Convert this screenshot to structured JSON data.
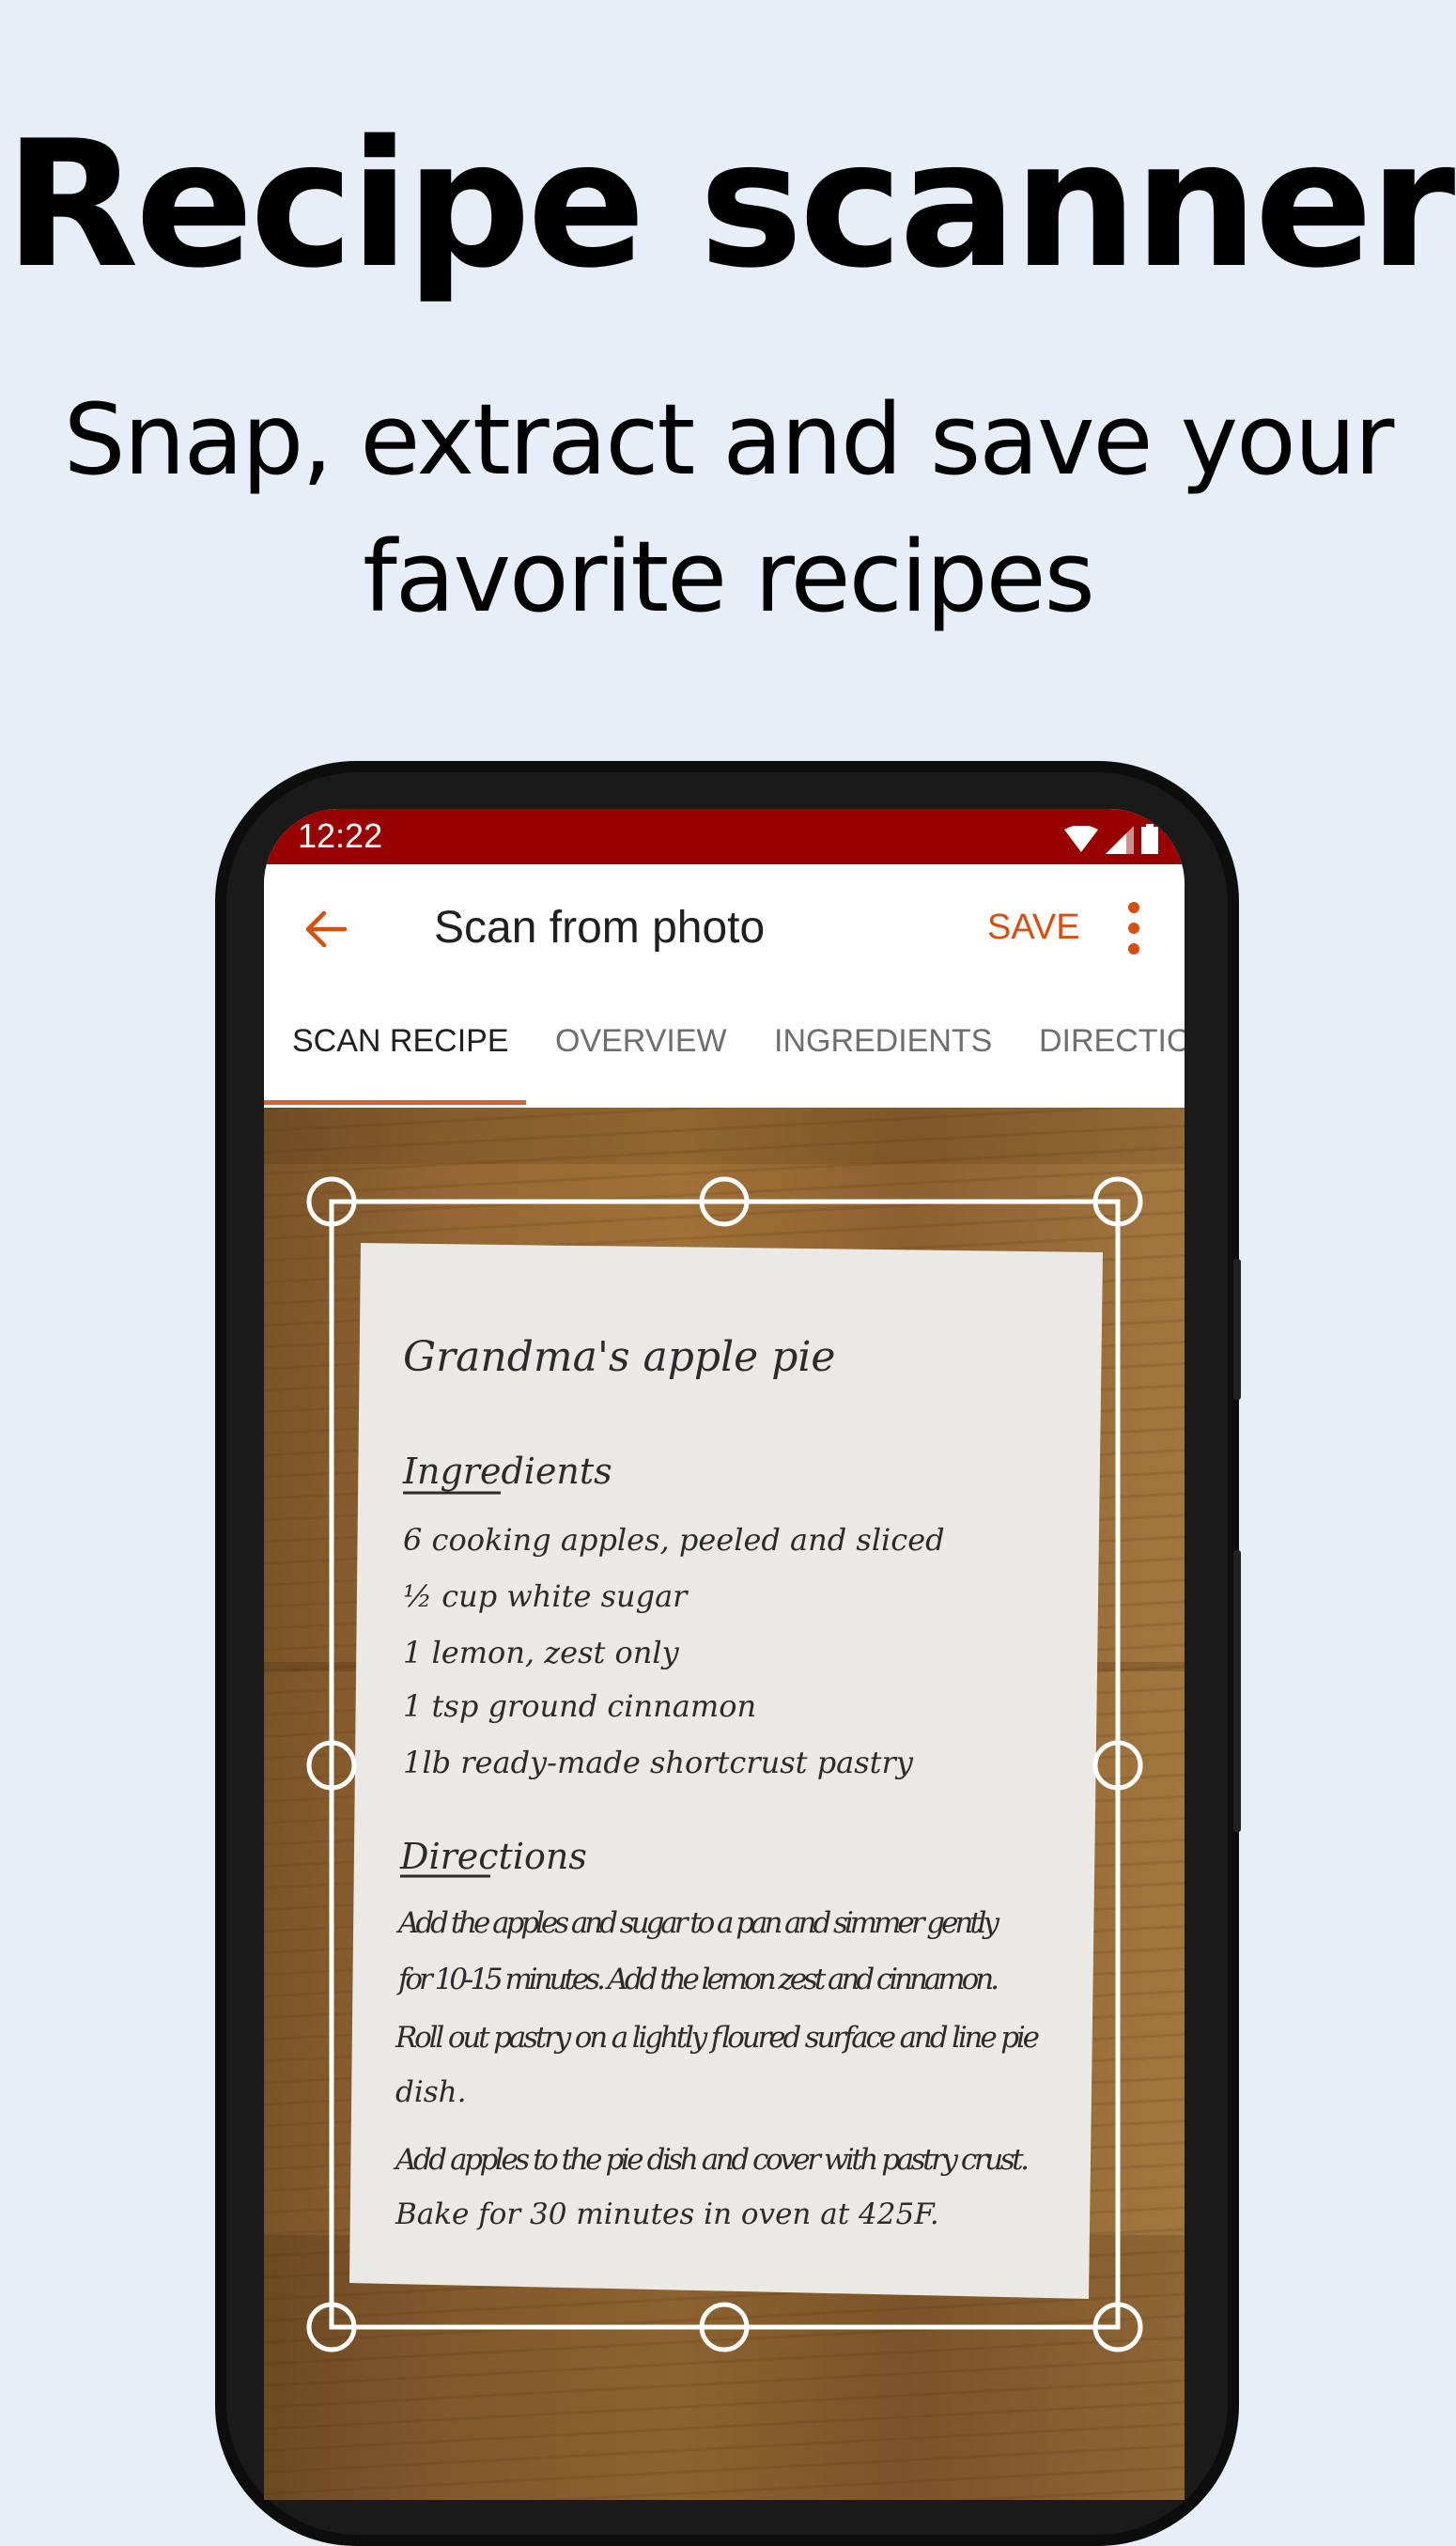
{
  "hero": {
    "title": "Recipe scanner",
    "subtitle_line1": "Snap, extract and save your",
    "subtitle_line2": "favorite recipes"
  },
  "status_bar": {
    "time": "12:22",
    "icons": [
      "wifi-icon",
      "signal-icon",
      "battery-icon"
    ],
    "color": "#990000"
  },
  "app_bar": {
    "back_icon": "arrow-left-icon",
    "title": "Scan from photo",
    "save_label": "SAVE",
    "more_icon": "more-vertical-icon",
    "accent": "#d5500f"
  },
  "tabs": [
    {
      "label": "SCAN RECIPE",
      "active": true
    },
    {
      "label": "OVERVIEW",
      "active": false
    },
    {
      "label": "INGREDIENTS",
      "active": false
    },
    {
      "label": "DIRECTIONS",
      "active": false
    }
  ],
  "scanned_recipe": {
    "title": "Grandma's apple pie",
    "ingredients_heading": "Ingredients",
    "ingredients": [
      "6 cooking apples, peeled and sliced",
      "½ cup white sugar",
      "1 lemon, zest only",
      "1 tsp ground cinnamon",
      "1lb ready-made shortcrust pastry"
    ],
    "directions_heading": "Directions",
    "directions_lines": [
      "Add the apples and sugar to a pan and simmer gently",
      "for 10-15 minutes. Add the lemon zest and cinnamon.",
      "Roll out pastry on a lightly floured surface and line pie",
      "dish.",
      "Add apples to the pie dish and cover with pastry crust.",
      "Bake for 30 minutes in oven at 425F."
    ]
  },
  "crop_frame": {
    "handles": [
      "top-left",
      "top-center",
      "top-right",
      "middle-left",
      "middle-right",
      "bottom-left",
      "bottom-center",
      "bottom-right"
    ]
  }
}
